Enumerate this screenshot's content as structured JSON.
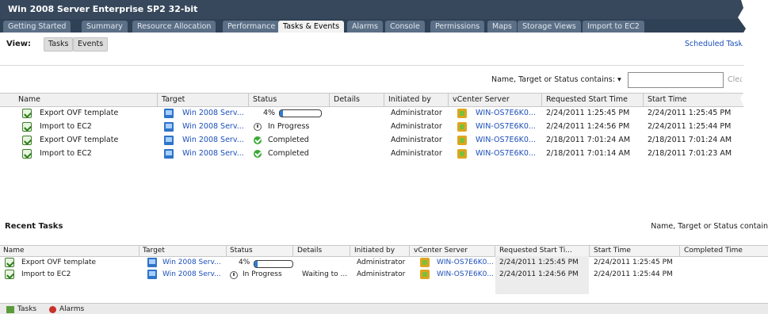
{
  "vm_title": "Win 2008 Server Enterprise SP2 32-bit",
  "tabs": [
    "Getting Started",
    "Summary",
    "Resource Allocation",
    "Performance",
    "Tasks & Events",
    "Alarms",
    "Console",
    "Permissions",
    "Maps",
    "Storage Views",
    "Import to EC2"
  ],
  "active_tab": "Tasks & Events",
  "view": {
    "label": "View:",
    "tasks": "Tasks",
    "events": "Events"
  },
  "scheduled_tasks": "Scheduled Tasks",
  "filter": {
    "label": "Name, Target or Status contains: ▾",
    "value": "",
    "clear": "Clea"
  },
  "columns": [
    "Name",
    "Target",
    "Status",
    "Details",
    "Initiated by",
    "vCenter Server",
    "Requested Start Time",
    "Start Time"
  ],
  "rows": [
    {
      "name": "Export OVF template",
      "target": "Win 2008 Serv...",
      "status": "4%",
      "progress": 0.04,
      "details": "",
      "initiated": "Administrator",
      "server": "WIN-OS7E6K0...",
      "requested": "2/24/2011 1:25:45 PM",
      "start": "2/24/2011 1:25:45 PM"
    },
    {
      "name": "Import to EC2",
      "target": "Win 2008 Serv...",
      "status": "In Progress",
      "details": "",
      "initiated": "Administrator",
      "server": "WIN-OS7E6K0...",
      "requested": "2/24/2011 1:24:56 PM",
      "start": "2/24/2011 1:25:44 PM"
    },
    {
      "name": "Export OVF template",
      "target": "Win 2008 Serv...",
      "status": "Completed",
      "details": "",
      "initiated": "Administrator",
      "server": "WIN-OS7E6K0...",
      "requested": "2/18/2011 7:01:24 AM",
      "start": "2/18/2011 7:01:24 AM"
    },
    {
      "name": "Import to EC2",
      "target": "Win 2008 Serv...",
      "status": "Completed",
      "details": "",
      "initiated": "Administrator",
      "server": "WIN-OS7E6K0...",
      "requested": "2/18/2011 7:01:14 AM",
      "start": "2/18/2011 7:01:23 AM"
    }
  ],
  "recent": {
    "title": "Recent Tasks",
    "filter_label": "Name, Target or Status contain",
    "columns": [
      "Name",
      "Target",
      "Status",
      "Details",
      "Initiated by",
      "vCenter Server",
      "Requested Start Ti...",
      "Start Time",
      "Completed Time"
    ],
    "rows": [
      {
        "name": "Export OVF template",
        "target": "Win 2008 Serv...",
        "status": "4%",
        "progress": 0.04,
        "details": "",
        "initiated": "Administrator",
        "server": "WIN-OS7E6K0...",
        "requested": "2/24/2011 1:25:45 PM",
        "start": "2/24/2011 1:25:45 PM",
        "completed": ""
      },
      {
        "name": "Import to EC2",
        "target": "Win 2008 Serv...",
        "status": "In Progress",
        "details": "Waiting to ...",
        "initiated": "Administrator",
        "server": "WIN-OS7E6K0...",
        "requested": "2/24/2011 1:24:56 PM",
        "start": "2/24/2011 1:25:44 PM",
        "completed": ""
      }
    ]
  },
  "bottom_tabs": {
    "tasks": "Tasks",
    "alarms": "Alarms"
  }
}
